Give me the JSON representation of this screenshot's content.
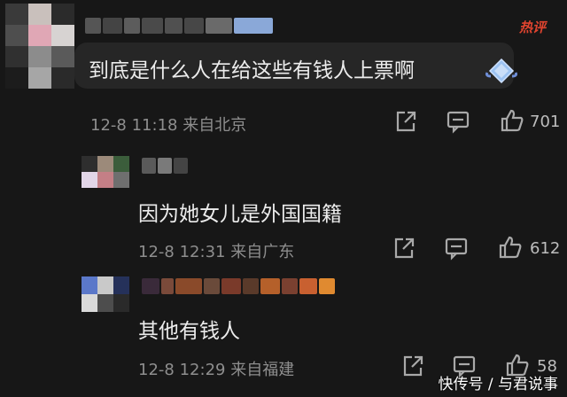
{
  "comments": [
    {
      "text": "到底是什么人在给这些有钱人上票啊",
      "date": "12-8",
      "time": "11:18",
      "location": "来自北京",
      "likes": "701"
    },
    {
      "text": "因为她女儿是外国国籍",
      "date": "12-8",
      "time": "12:31",
      "location": "来自广东",
      "likes": "612"
    },
    {
      "text": "其他有钱人",
      "date": "12-8",
      "time": "12:29",
      "location": "来自福建",
      "likes": "58"
    }
  ],
  "hot_label": "热评",
  "watermark": "快传号 / 与君说事",
  "icons": {
    "share": "share-icon",
    "reply": "comment-icon",
    "like": "thumbs-up-icon",
    "badge": "diamond-badge-icon"
  },
  "colors": {
    "background": "#171717",
    "hot": "#e0442f",
    "muted": "#8e8e8e"
  }
}
